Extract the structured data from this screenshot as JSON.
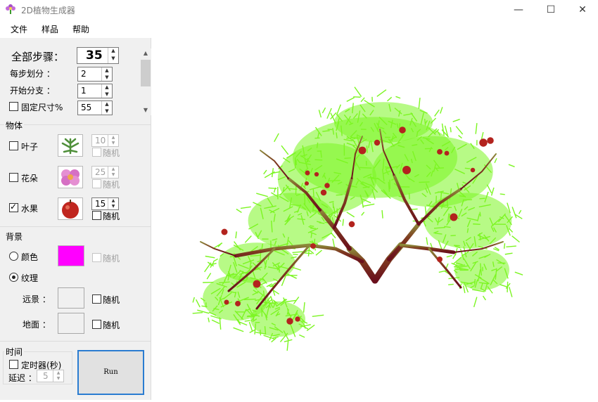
{
  "window": {
    "title": "2D植物生成器",
    "min_icon": "minimize-icon",
    "max_icon": "maximize-icon",
    "close_icon": "close-icon"
  },
  "menu": [
    {
      "label": "文件"
    },
    {
      "label": "样品"
    },
    {
      "label": "帮助"
    }
  ],
  "params": {
    "total_steps_label": "全部步骤：",
    "total_steps": "35",
    "sub_per_step_label": "每步划分 ：",
    "sub_per_step": "2",
    "start_branch_label": "开始分支 ：",
    "start_branch": "1",
    "fixed_size_label": "固定尺寸%",
    "fixed_size": "55",
    "fixed_size_checked": false
  },
  "objects": {
    "title": "物体",
    "items": [
      {
        "label": "叶子",
        "checked": false,
        "count": "10",
        "random": "随机",
        "enabled": false,
        "icon": "leaf-icon"
      },
      {
        "label": "花朵",
        "checked": false,
        "count": "25",
        "random": "随机",
        "enabled": false,
        "icon": "flower-icon"
      },
      {
        "label": "水果",
        "checked": true,
        "count": "15",
        "random": "随机",
        "enabled": true,
        "icon": "apple-icon"
      }
    ]
  },
  "background": {
    "title": "背景",
    "color_label": "颜色",
    "color_random": "随机",
    "color": "#ff00ff",
    "texture_label": "纹理",
    "texture_selected": true,
    "far_label": "远景 ：",
    "far_random": "随机",
    "ground_label": "地面 ：",
    "ground_random": "随机"
  },
  "time": {
    "title": "时间",
    "timer_label": "定时器(秒)",
    "timer_checked": false,
    "delay_label": "延迟 ：",
    "delay": "5"
  },
  "run": {
    "label": "Run"
  },
  "colors": {
    "leaf": "#7cf522",
    "trunk": "#6a0f1c",
    "fruit": "#b3231e",
    "accent": "#2a7cd1"
  }
}
